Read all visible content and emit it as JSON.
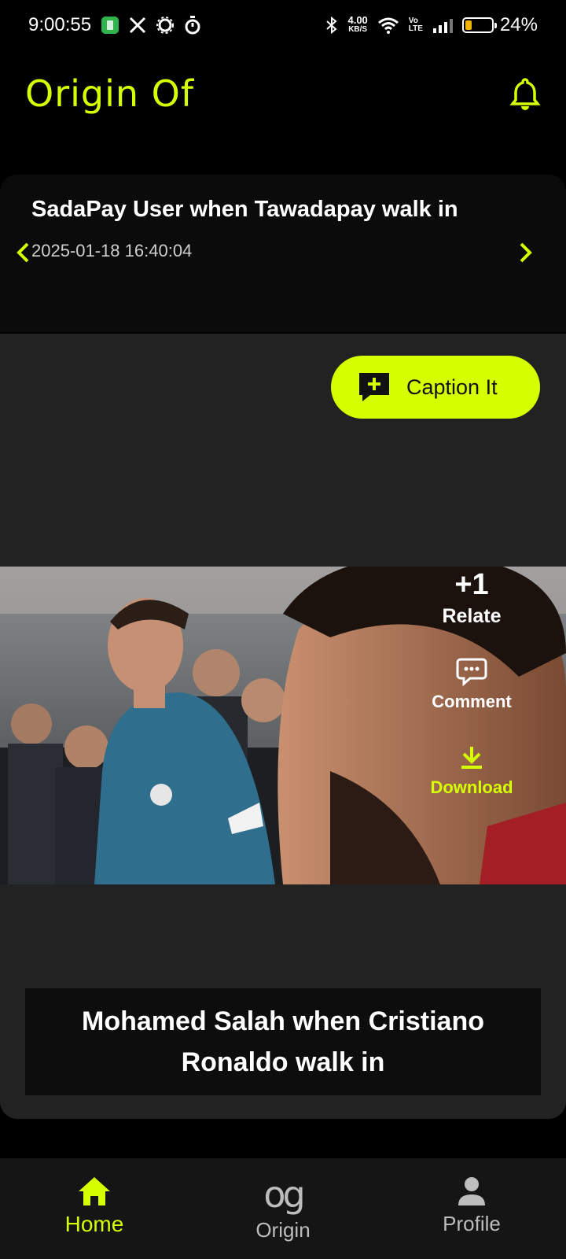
{
  "status_bar": {
    "time": "9:00:55",
    "net_speed_value": "4.00",
    "net_speed_unit": "KB/S",
    "volte_top": "Vo",
    "volte_bottom": "LTE",
    "battery_percent": "24%",
    "battery_level": 0.24
  },
  "header": {
    "title": "Origin Of",
    "notification_icon": "bell-icon"
  },
  "topic": {
    "title": "SadaPay User when Tawadapay walk in",
    "timestamp": "2025-01-18 16:40:04"
  },
  "card": {
    "caption_button_label": "Caption It",
    "relate_count": "+1",
    "relate_label": "Relate",
    "comment_label": "Comment",
    "download_label": "Download",
    "caption_text": "Mohamed Salah when Cristiano Ronaldo walk in"
  },
  "bottom_nav": {
    "items": [
      {
        "label": "Home",
        "icon": "home-icon",
        "active": true
      },
      {
        "label": "Origin",
        "icon": "og",
        "active": false
      },
      {
        "label": "Profile",
        "icon": "person-icon",
        "active": false
      }
    ]
  },
  "colors": {
    "accent": "#d6ff00",
    "background": "#000000",
    "card": "#222222"
  }
}
